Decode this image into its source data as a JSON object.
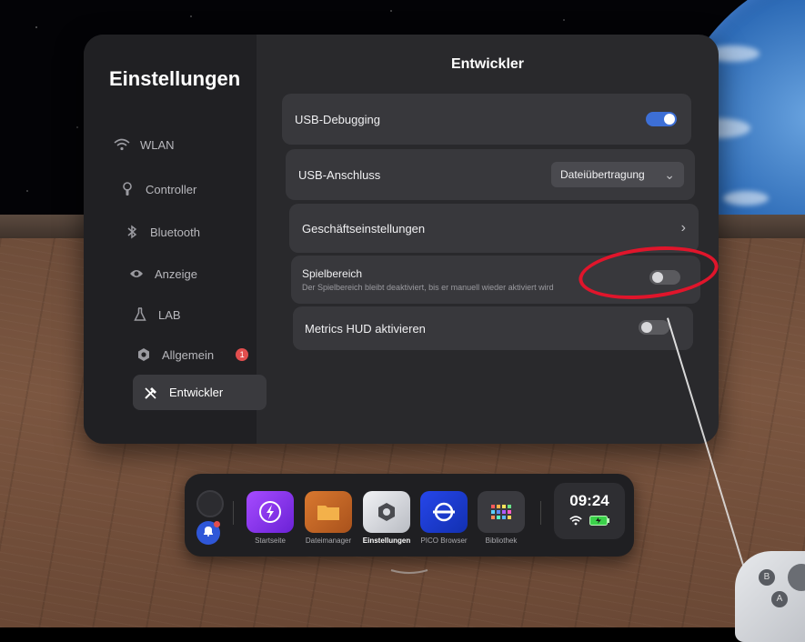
{
  "settings": {
    "title": "Einstellungen",
    "nav": [
      {
        "label": "WLAN",
        "icon": "wifi-icon"
      },
      {
        "label": "Controller",
        "icon": "controller-icon"
      },
      {
        "label": "Bluetooth",
        "icon": "bluetooth-icon"
      },
      {
        "label": "Anzeige",
        "icon": "eye-icon"
      },
      {
        "label": "LAB",
        "icon": "flask-icon"
      },
      {
        "label": "Allgemein",
        "icon": "gear-icon",
        "badge": "1"
      },
      {
        "label": "Entwickler",
        "icon": "tools-icon",
        "active": true
      }
    ]
  },
  "developer": {
    "title": "Entwickler",
    "usb_debugging": {
      "label": "USB-Debugging",
      "enabled": true
    },
    "usb_connection": {
      "label": "USB-Anschluss",
      "value": "Dateiübertragung"
    },
    "business_settings": {
      "label": "Geschäftseinstellungen"
    },
    "play_area": {
      "label": "Spielbereich",
      "description": "Der Spielbereich bleibt deaktiviert, bis er manuell wieder aktiviert wird",
      "enabled": false
    },
    "metrics_hud": {
      "label": "Metrics HUD aktivieren",
      "enabled": false
    }
  },
  "taskbar": {
    "apps": [
      {
        "label": "Startseite",
        "icon": "lightning-icon",
        "color": "#8b3cf0"
      },
      {
        "label": "Dateimanager",
        "icon": "folder-icon",
        "color": "#c76a2a"
      },
      {
        "label": "Einstellungen",
        "icon": "settings-hex-icon",
        "color": "#d9dbe0",
        "active": true
      },
      {
        "label": "PICO Browser",
        "icon": "browser-icon",
        "color": "#1a3bd1"
      },
      {
        "label": "Bibliothek",
        "icon": "grid-icon",
        "color": "#3a3a3f"
      }
    ],
    "clock": {
      "time": "09:24"
    }
  },
  "colors": {
    "accent": "#3d6fd6",
    "annotation": "#e0152b",
    "badge": "#e24e4e"
  }
}
